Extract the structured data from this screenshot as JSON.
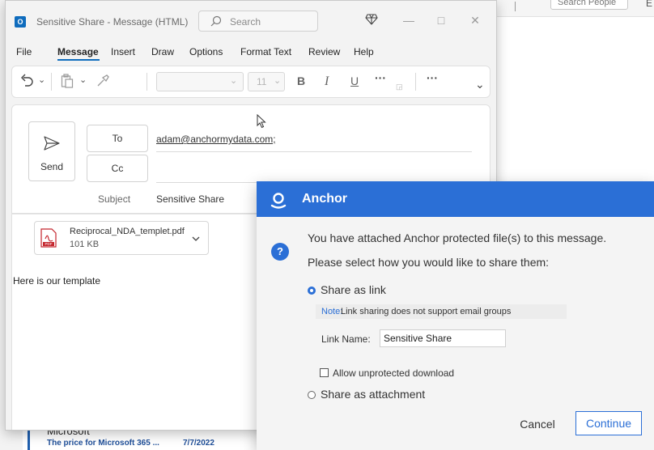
{
  "background": {
    "search_people": "Search People",
    "edge_char": "E",
    "mail_list": {
      "sender": "Microsoft",
      "subject": "The price for Microsoft 365 ...",
      "date": "7/7/2022"
    }
  },
  "window": {
    "title": "Sensitive Share  -  Message (HTML)",
    "search_placeholder": "Search",
    "app_icon_letter": "O",
    "controls": {
      "minimize": "—",
      "maximize": "□",
      "close": "✕"
    }
  },
  "menu": {
    "items": [
      "File",
      "Message",
      "Insert",
      "Draw",
      "Options",
      "Format Text",
      "Review",
      "Help"
    ],
    "active": "Message"
  },
  "ribbon": {
    "font_size": "11",
    "bold": "B",
    "italic": "I",
    "underline": "U",
    "more1": "···",
    "more2": "···",
    "expand": "⌄"
  },
  "compose": {
    "send_label": "Send",
    "to_label": "To",
    "cc_label": "Cc",
    "to_value": "adam@anchormydata.com;",
    "subject_label": "Subject",
    "subject_value": "Sensitive Share",
    "attachment": {
      "name": "Reciprocal_NDA_templet.pdf",
      "size": "101 KB",
      "type_label": "PDF"
    },
    "body": "Here is our template"
  },
  "dialog": {
    "title": "Anchor",
    "question_icon": "?",
    "message_line1": "You have attached Anchor protected file(s) to this message.",
    "message_line2": "Please select how you would like to share them:",
    "option_link": "Share as link",
    "note_label": "Note:",
    "note_text": "Link sharing does not support email groups",
    "link_name_label": "Link Name:",
    "link_name_value": "Sensitive Share",
    "allow_download_label": "Allow unprotected download",
    "option_attachment": "Share as attachment",
    "cancel_label": "Cancel",
    "continue_label": "Continue",
    "accent_color": "#2b6fd6"
  }
}
